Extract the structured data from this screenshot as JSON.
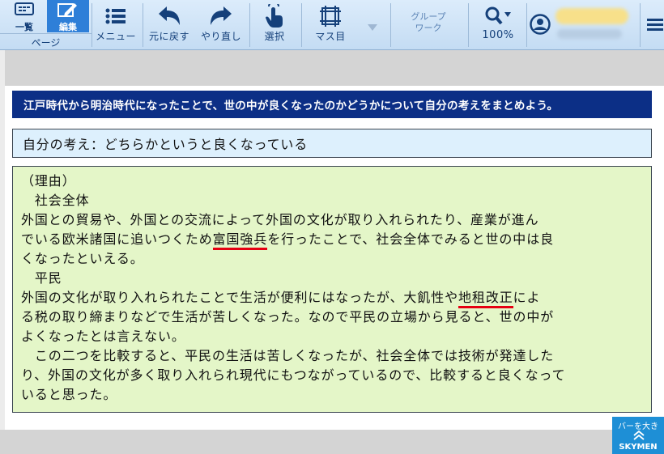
{
  "toolbar": {
    "page_group": {
      "list_label": "一覧",
      "edit_label": "編集",
      "group_label": "ページ"
    },
    "menu_label": "メニュー",
    "undo_label": "元に戻す",
    "redo_label": "やり直し",
    "select_label": "選択",
    "grid_label": "マス目",
    "group_work_line1": "グループ",
    "group_work_line2": "ワーク",
    "zoom_label": "100%",
    "icons": [
      "list-icon",
      "edit-icon",
      "menu-icon",
      "undo-icon",
      "redo-icon",
      "touch-icon",
      "grid-icon",
      "dropdown-arrow-icon",
      "zoom-icon",
      "user-icon",
      "hamburger-icon"
    ]
  },
  "content": {
    "question": "江戸時代から明治時代になったことで、世の中が良くなったのかどうかについて自分の考えをまとめよう。",
    "opinion": "自分の考え：どちらかというと良くなっている",
    "reason": {
      "l1": "（理由）",
      "l2": "　社会全体",
      "l3": "外国との貿易や、外国との交流によって外国の文化が取り入れられたり、産業が進ん",
      "l4a": "でいる欧米諸国に追いつくため",
      "l4u": "富国強兵",
      "l4b": "を行ったことで、社会全体でみると世の中は良",
      "l5": "くなったといえる。",
      "l6": "　平民",
      "l7a": "外国の文化が取り入れられたことで生活が便利にはなったが、大飢性や",
      "l7u": "地租改正",
      "l7b": "によ",
      "l8": "る税の取り締まりなどで生活が苦しくなった。なので平民の立場から見ると、世の中が",
      "l9": "よくなったとは言えない。",
      "l10": "　この二つを比較すると、平民の生活は苦しくなったが、社会全体では技術が発達した",
      "l11": "り、外国の文化が多く取り入れられ現代にもつながっているので、比較すると良くなって",
      "l12": "いると思った。"
    }
  },
  "sky_button": {
    "top": "バーを大き",
    "bottom": "SKYMEN"
  },
  "colors": {
    "toolbar": "#c4dcf3",
    "question_bg": "#0c2f86",
    "opinion_bg": "#ddf0fd",
    "reason_bg": "#e4f6c8",
    "underline": "#e60012"
  }
}
